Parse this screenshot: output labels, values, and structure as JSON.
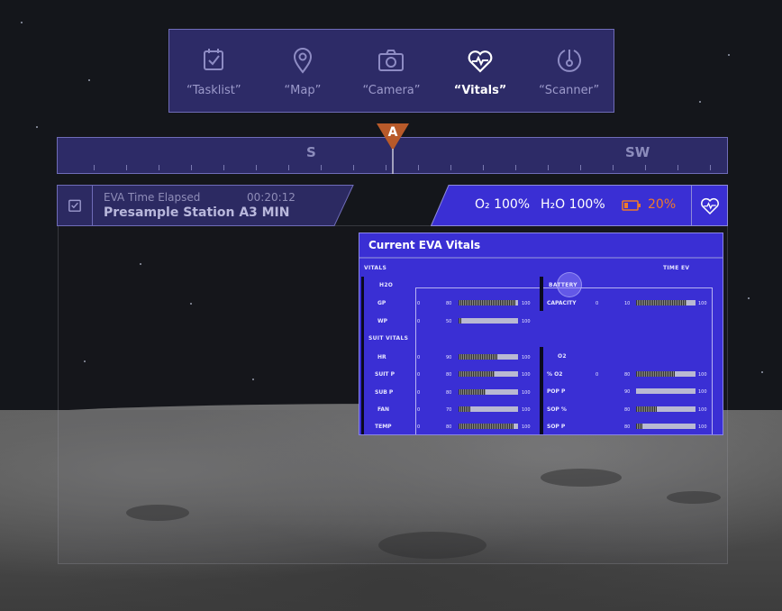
{
  "nav": {
    "items": [
      {
        "label": "“Tasklist”",
        "icon": "checklist-icon",
        "active": false
      },
      {
        "label": "“Map”",
        "icon": "map-pin-icon",
        "active": false
      },
      {
        "label": "“Camera”",
        "icon": "camera-icon",
        "active": false
      },
      {
        "label": "“Vitals”",
        "icon": "heart-pulse-icon",
        "active": true
      },
      {
        "label": "“Scanner”",
        "icon": "gauge-icon",
        "active": false
      }
    ]
  },
  "compass": {
    "directions": [
      "S",
      "SW"
    ],
    "marker": "A",
    "marker_color": "#b85a2a"
  },
  "task": {
    "elapsed_label": "EVA Time Elapsed",
    "elapsed_value": "00:20:12",
    "station": "Presample Station A",
    "duration": "3 MIN"
  },
  "resources": {
    "o2": "O₂ 100%",
    "h2o": "H₂O 100%",
    "battery": "20%",
    "battery_color": "#f07a2a"
  },
  "vitals": {
    "title": "Current EVA Vitals",
    "section_vitals": "VITALS",
    "time_label": "TIME EV",
    "battery_section": "BATTERY",
    "suit_vitals": "SUIT VITALS",
    "o2_section": "O2",
    "h2o_label": "H2O",
    "rows_left": [
      {
        "label": "GP",
        "min": "0",
        "val": "80",
        "max": "100",
        "level": 0.95
      },
      {
        "label": "WP",
        "min": "0",
        "val": "50",
        "max": "100",
        "level": 0.05
      },
      {
        "label": "HR",
        "min": "0",
        "val": "90",
        "max": "100",
        "level": 0.65
      },
      {
        "label": "SUIT P",
        "min": "0",
        "val": "80",
        "max": "100",
        "level": 0.6
      },
      {
        "label": "SUB P",
        "min": "0",
        "val": "80",
        "max": "100",
        "level": 0.45
      },
      {
        "label": "FAN",
        "min": "0",
        "val": "70",
        "max": "100",
        "level": 0.2
      },
      {
        "label": "TEMP",
        "min": "0",
        "val": "80",
        "max": "100",
        "level": 0.92
      }
    ],
    "rows_right": [
      {
        "label": "CAPACITY",
        "min": "0",
        "val": "10",
        "max": "100",
        "level": 0.85
      },
      {
        "label": "% O2",
        "min": "0",
        "val": "80",
        "max": "100",
        "level": 0.65
      },
      {
        "label": "POP P",
        "min": "",
        "val": "90",
        "max": "100",
        "level": 0.0
      },
      {
        "label": "SOP %",
        "min": "",
        "val": "80",
        "max": "100",
        "level": 0.35
      },
      {
        "label": "SOP P",
        "min": "",
        "val": "80",
        "max": "100",
        "level": 0.1
      }
    ]
  }
}
